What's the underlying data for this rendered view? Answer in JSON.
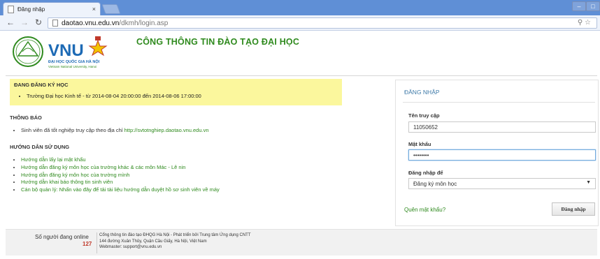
{
  "browser": {
    "tab_title": "Đăng nhập",
    "tab_close": "×",
    "url_host": "daotao.vnu.edu.vn",
    "url_path": "/dkmh/login.asp",
    "back_icon": "back-arrow-icon",
    "forward_icon": "forward-arrow-icon",
    "reload_icon": "reload-icon"
  },
  "header": {
    "logo_text": "VNU",
    "logo_sub": "ĐẠI HỌC QUỐC GIA HÀ NỘI",
    "logo_sub_en": "Vietnam National University, Hanoi",
    "site_title": "CÔNG THÔNG TIN ĐÀO TẠO ĐẠI HỌC"
  },
  "notice": {
    "title": "ĐANG ĐĂNG KÝ HỌC",
    "items": [
      "Trường Đại học Kinh tế - từ 2014-08-04 20:00:00 đến 2014-08-06 17:00:00"
    ]
  },
  "announcements": {
    "title": "THÔNG BÁO",
    "item_text": "Sinh viên đã tốt nghiệp truy cập theo địa chỉ ",
    "item_link": "http://svtotnghiep.daotao.vnu.edu.vn"
  },
  "guides": {
    "title": "HƯỚNG DẪN SỬ DỤNG",
    "items": [
      "Hướng dẫn lấy lại mật khẩu",
      "Hướng dẫn đăng ký môn học của trường khác & các môn Mác - Lê nin",
      "Hướng dẫn đăng ký môn học của trường mình",
      "Hướng dẫn khai báo thông tin sinh viên",
      "Cán bộ quản lý: Nhấn vào đây để tải tài liệu hướng dẫn duyệt hồ sơ sinh viên về máy"
    ]
  },
  "login": {
    "title": "ĐĂNG NHẬP",
    "username_label": "Tên truy cập",
    "username_value": "11050652",
    "password_label": "Mật khẩu",
    "password_value": "password",
    "mode_label": "Đăng nhập để",
    "mode_value": "Đăng ký môn học",
    "forgot_label": "Quên mật khẩu?",
    "submit_label": "Đăng nhập"
  },
  "footer": {
    "online_label": "Số người đang online",
    "online_count": "127",
    "line1": "Cổng thông tin đào tạo ĐHQG Hà Nội - Phát triển bởi Trung tâm Ứng dụng CNTT",
    "line2": "144 đường Xuân Thủy, Quận Cầu Giấy, Hà Nội, Việt Nam",
    "line3": "Webmaster: support@vnu.edu.vn"
  },
  "colors": {
    "accent_green": "#2f8a1e",
    "notice_bg": "#fbf79d",
    "login_title": "#3e7aa8"
  }
}
